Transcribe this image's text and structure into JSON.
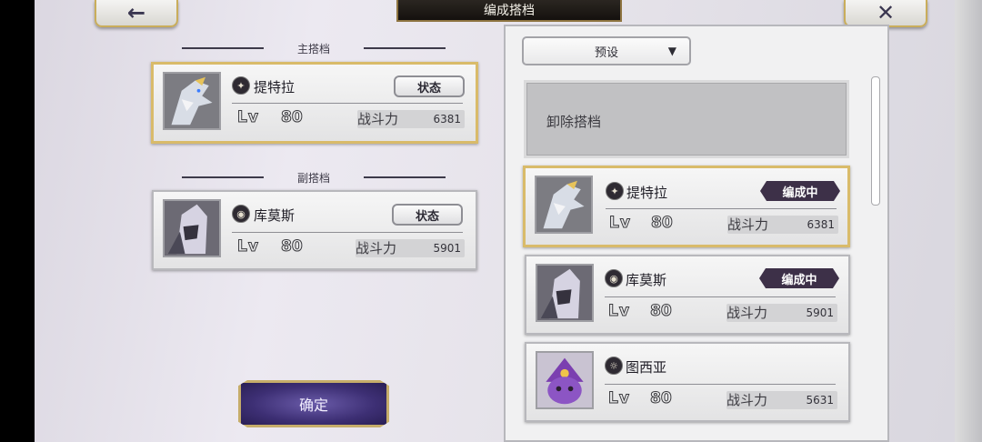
{
  "header": {
    "title": "编成搭档",
    "back_icon": "arrow-left-icon",
    "close_icon": "close-icon"
  },
  "left": {
    "main_partner_header": "主搭档",
    "sub_partner_header": "副搭档",
    "confirm_label": "确定",
    "main_card": {
      "name": "提特拉",
      "level_label": "Lv",
      "level": "80",
      "power_label": "战斗力",
      "power": "6381",
      "status_label": "状态",
      "attribute_icon": "sparkle-icon"
    },
    "sub_card": {
      "name": "库莫斯",
      "level_label": "Lv",
      "level": "80",
      "power_label": "战斗力",
      "power": "5901",
      "status_label": "状态",
      "attribute_icon": "eye-icon"
    }
  },
  "right": {
    "preset_label": "预设",
    "remove_label": "卸除搭档",
    "list": [
      {
        "name": "提特拉",
        "level_label": "Lv",
        "level": "80",
        "power_label": "战斗力",
        "power": "6381",
        "badge": "编成中",
        "attribute_icon": "sparkle-icon"
      },
      {
        "name": "库莫斯",
        "level_label": "Lv",
        "level": "80",
        "power_label": "战斗力",
        "power": "5901",
        "badge": "编成中",
        "attribute_icon": "eye-icon"
      },
      {
        "name": "图西亚",
        "level_label": "Lv",
        "level": "80",
        "power_label": "战斗力",
        "power": "5631",
        "badge": "",
        "attribute_icon": "swirl-icon"
      }
    ]
  },
  "colors": {
    "gold_border": "#d9bb6a",
    "badge_bg": "#3d3048",
    "confirm_bg": "#3d2f74"
  }
}
